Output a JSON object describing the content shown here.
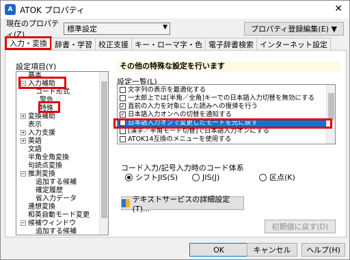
{
  "window": {
    "title": "ATOK プロパティ",
    "app_icon": "A"
  },
  "property": {
    "label": "現在のプロパティ(Z)",
    "value": "標準設定",
    "edit_button": "プロパティ登録編集(E) ▼"
  },
  "tabs": [
    {
      "label": "入力・変換",
      "active": true
    },
    {
      "label": "辞書・学習"
    },
    {
      "label": "校正支援"
    },
    {
      "label": "キー・ローマ字・色"
    },
    {
      "label": "電子辞書検索"
    },
    {
      "label": "インターネット設定"
    }
  ],
  "settings": {
    "label": "設定項目(Y)"
  },
  "tree": [
    {
      "label": "基本",
      "expander": "",
      "indent": 1
    },
    {
      "label": "入力補助",
      "expander": "-",
      "indent": 0
    },
    {
      "label": "コード形式",
      "expander": "",
      "indent": 2
    },
    {
      "label": "警告",
      "expander": "",
      "indent": 2
    },
    {
      "label": "特殊",
      "expander": "",
      "indent": 2
    },
    {
      "label": "変換補助",
      "expander": "+",
      "indent": 0
    },
    {
      "label": "表示",
      "expander": "",
      "indent": 1
    },
    {
      "label": "入力支援",
      "expander": "+",
      "indent": 0
    },
    {
      "label": "英語",
      "expander": "+",
      "indent": 0
    },
    {
      "label": "文語",
      "expander": "",
      "indent": 1
    },
    {
      "label": "半角全角変換",
      "expander": "",
      "indent": 1
    },
    {
      "label": "句読点変換",
      "expander": "",
      "indent": 1
    },
    {
      "label": "推測変換",
      "expander": "-",
      "indent": 0
    },
    {
      "label": "追加する候補",
      "expander": "",
      "indent": 2
    },
    {
      "label": "確定履歴",
      "expander": "",
      "indent": 2
    },
    {
      "label": "省入力データ",
      "expander": "",
      "indent": 2
    },
    {
      "label": "連想変換",
      "expander": "",
      "indent": 1
    },
    {
      "label": "和英自動モード変更",
      "expander": "",
      "indent": 1
    },
    {
      "label": "候補ウィンドウ",
      "expander": "-",
      "indent": 0
    },
    {
      "label": "追加する候補",
      "expander": "",
      "indent": 2
    }
  ],
  "heading": "その他の特殊な設定を行います",
  "list": {
    "label": "設定一覧(L)",
    "items": [
      {
        "text": "文字列の表示を最適化する",
        "checked": false
      },
      {
        "text": "一太郎上では[半角／全角]キーでの日本語入力切替を無効にする",
        "checked": false
      },
      {
        "text": "直前の入力を対象にした読みへの復帰を行う",
        "checked": true
      },
      {
        "text": "日本語入力オンへの切替を通知する",
        "checked": true
      },
      {
        "text": "日本語入力オンで変更したモードを元に戻す",
        "checked": false,
        "selected": true
      },
      {
        "text": "[漢字／半角モード切替]で日本語入力オンにする",
        "checked": false
      },
      {
        "text": "ATOK14互換のメニューを使用する",
        "checked": false
      }
    ]
  },
  "code_system": {
    "label": "コード入力/記号入力時のコード体系",
    "options": [
      {
        "label": "シフトJIS(S)",
        "selected": true
      },
      {
        "label": "JIS(J)",
        "selected": false
      },
      {
        "label": "区点(K)",
        "selected": false
      }
    ]
  },
  "buttons": {
    "text_services": "テキストサービスの詳細設定(T)...",
    "reset": "初期値に戻す(D)",
    "ok": "OK",
    "cancel": "キャンセル",
    "help": "ヘルプ(H)"
  },
  "icons": {
    "app": "atok-app-icon",
    "close": "close-icon",
    "shield": "uac-shield-icon"
  }
}
